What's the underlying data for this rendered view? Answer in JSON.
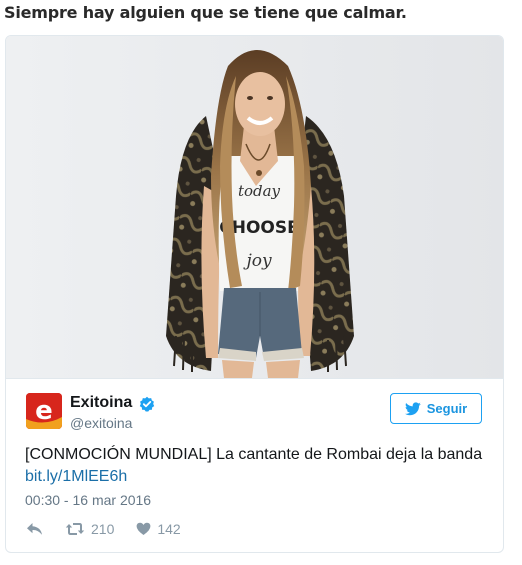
{
  "headline": "Siempre hay alguien que se tiene que calmar.",
  "photo": {
    "shirt_text": [
      "today",
      "CHOOSE",
      "joy"
    ]
  },
  "tweet": {
    "name": "Exitoina",
    "handle": "@exitoina",
    "avatar_letter": "e",
    "verified": true,
    "follow_label": "Seguir",
    "text": "[CONMOCIÓN MUNDIAL] La cantante de Rombai deja la banda",
    "link": "bit.ly/1MlEE6h",
    "timestamp": "00:30 - 16 mar 2016",
    "retweets": "210",
    "likes": "142"
  },
  "colors": {
    "brand_blue": "#1da1f2",
    "avatar_red": "#d7261c",
    "text_dark": "#14171a",
    "text_gray": "#657786"
  },
  "icons": {
    "verified": "verified-badge-icon",
    "follow": "twitter-bird-icon",
    "reply": "reply-arrow-icon",
    "retweet": "retweet-icon",
    "like": "heart-icon"
  }
}
